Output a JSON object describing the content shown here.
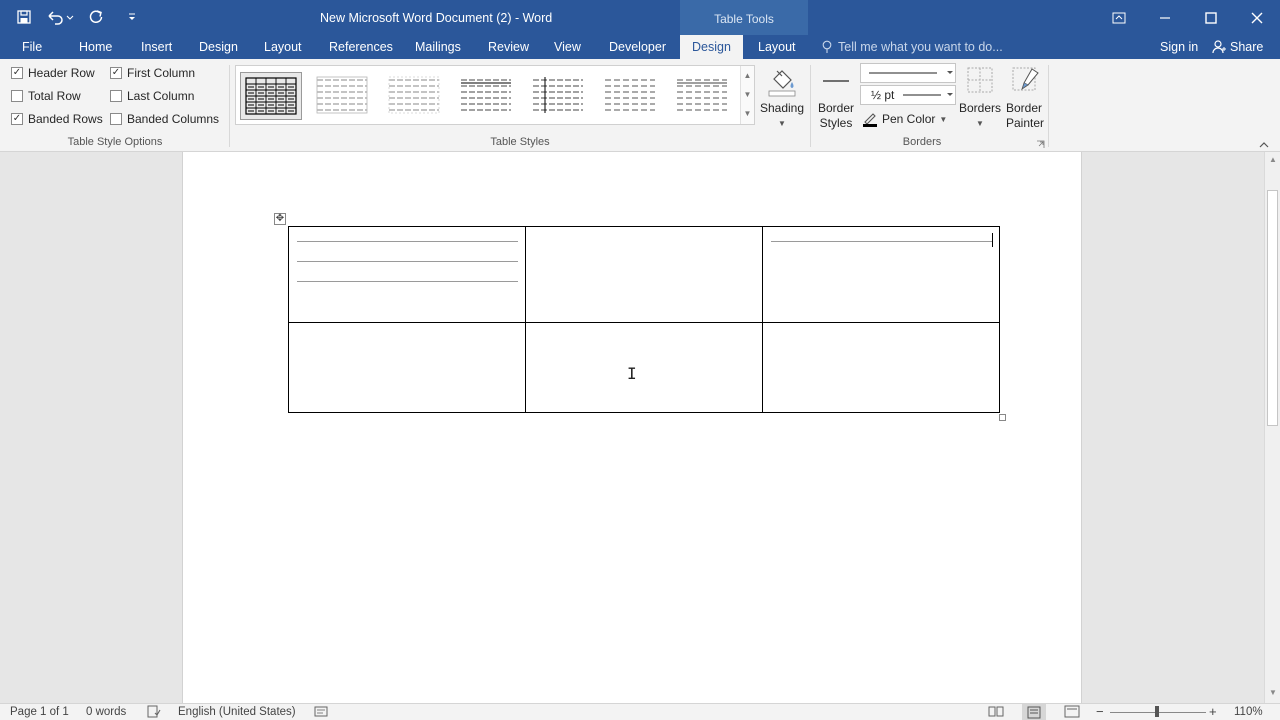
{
  "title": "New Microsoft Word Document (2) - Word",
  "context_tab_group": "Table Tools",
  "tabs": [
    "File",
    "Home",
    "Insert",
    "Design",
    "Layout",
    "References",
    "Mailings",
    "Review",
    "View",
    "Developer",
    "Design",
    "Layout"
  ],
  "active_tab_index": 10,
  "tell_me_placeholder": "Tell me what you want to do...",
  "sign_in": "Sign in",
  "share": "Share",
  "table_style_options": {
    "label": "Table Style Options",
    "checkboxes": [
      {
        "label": "Header Row",
        "checked": true
      },
      {
        "label": "Total Row",
        "checked": false
      },
      {
        "label": "Banded Rows",
        "checked": true
      },
      {
        "label": "First Column",
        "checked": true
      },
      {
        "label": "Last Column",
        "checked": false
      },
      {
        "label": "Banded Columns",
        "checked": false
      }
    ]
  },
  "table_styles": {
    "label": "Table Styles",
    "shading": "Shading"
  },
  "borders_group": {
    "label": "Borders",
    "border_styles": "Border Styles",
    "weight": "½ pt",
    "pen_color": "Pen Color",
    "borders": "Borders",
    "border_painter": "Border Painter"
  },
  "status": {
    "page": "Page 1 of 1",
    "words": "0 words",
    "language": "English (United States)",
    "zoom": "110%"
  },
  "colors": {
    "accent": "#2b579a"
  }
}
